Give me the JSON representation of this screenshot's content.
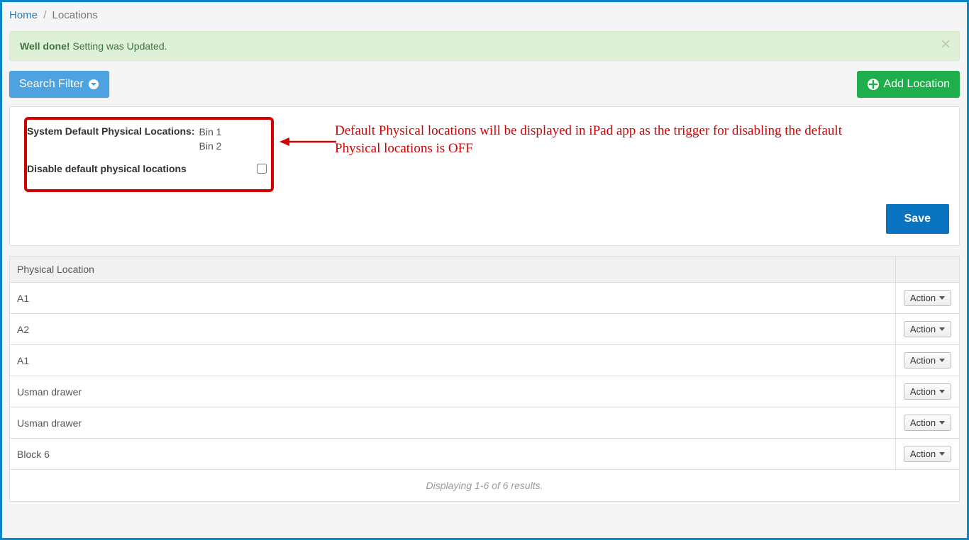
{
  "breadcrumb": {
    "home": "Home",
    "current": "Locations"
  },
  "alert": {
    "strong": "Well done!",
    "text": " Setting was Updated."
  },
  "toolbar": {
    "search_filter_label": "Search Filter",
    "add_location_label": "Add Location"
  },
  "settings": {
    "default_label": "System Default Physical Locations:",
    "bins": [
      "Bin 1",
      "Bin 2"
    ],
    "disable_label": "Disable default physical locations",
    "disable_checked": false,
    "save_label": "Save"
  },
  "annotation": {
    "text": "Default Physical locations will be displayed in iPad app as the trigger for disabling the default Physical locations is OFF"
  },
  "table": {
    "header_location": "Physical Location",
    "action_label": "Action",
    "rows": [
      {
        "name": "A1"
      },
      {
        "name": "A2"
      },
      {
        "name": "A1"
      },
      {
        "name": "Usman drawer"
      },
      {
        "name": "Usman drawer"
      },
      {
        "name": "Block 6"
      }
    ]
  },
  "pager": {
    "text": "Displaying 1-6 of 6 results."
  }
}
